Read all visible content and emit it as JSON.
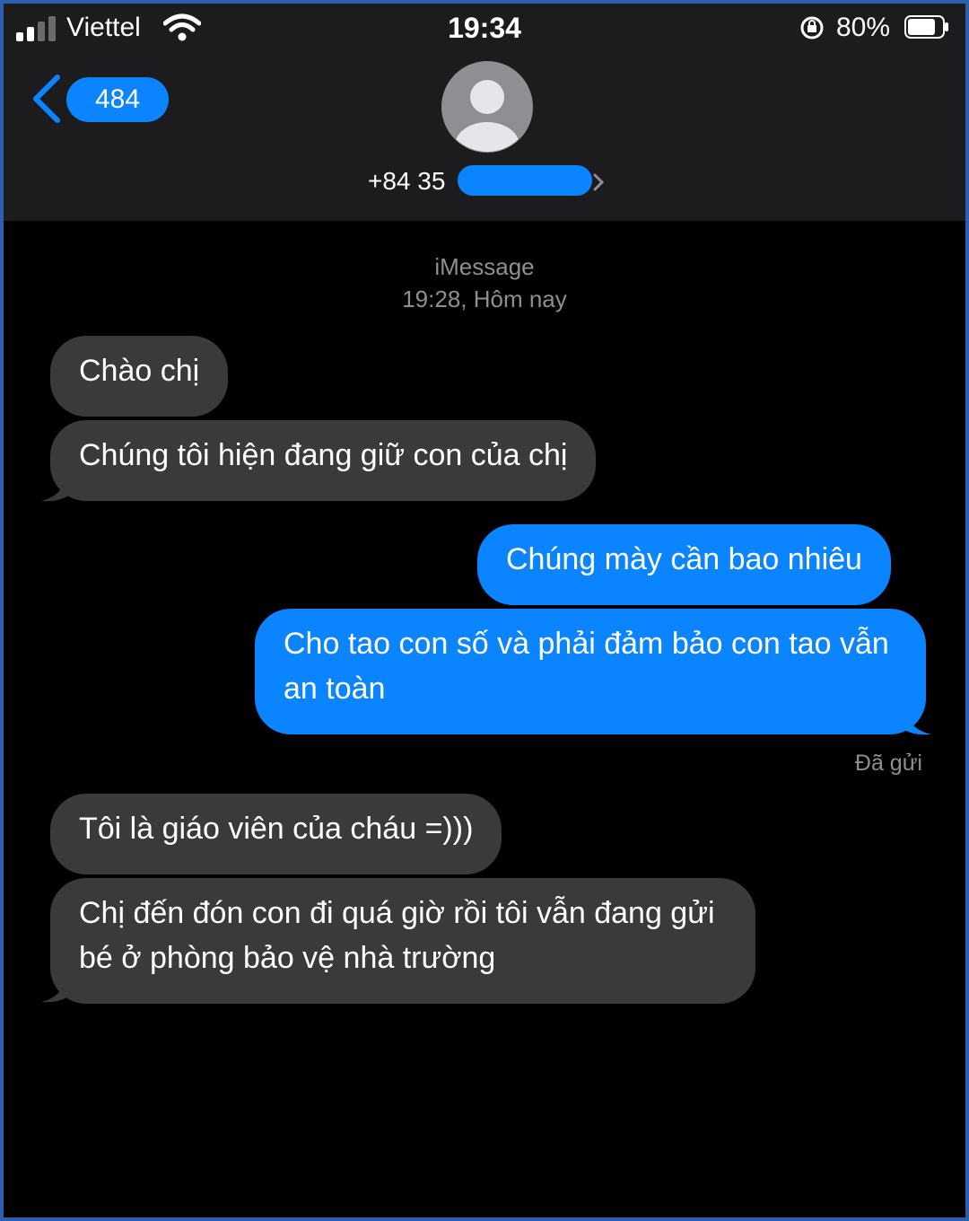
{
  "status_bar": {
    "carrier": "Viettel",
    "time": "19:34",
    "battery_percent": "80%",
    "signal_bars_full": 2,
    "battery_level": 0.8
  },
  "header": {
    "back_count": "484",
    "contact_number_visible": "+84 35"
  },
  "conversation": {
    "service": "iMessage",
    "timestamp": "19:28, Hôm nay",
    "messages": [
      {
        "direction": "incoming",
        "text": "Chào chị"
      },
      {
        "direction": "incoming",
        "text": "Chúng tôi hiện đang giữ con của chị"
      },
      {
        "direction": "outgoing",
        "text": "Chúng mày cần bao nhiêu"
      },
      {
        "direction": "outgoing",
        "text": "Cho tao con số và phải đảm bảo con tao vẫn an toàn"
      },
      {
        "direction": "incoming",
        "text": "Tôi là giáo viên của cháu =)))"
      },
      {
        "direction": "incoming",
        "text": "Chị đến đón con đi quá giờ rồi tôi vẫn đang gửi bé ở phòng bảo vệ nhà trường"
      }
    ],
    "delivery_status": "Đã gửi"
  },
  "colors": {
    "incoming_bubble": "#3a3a3c",
    "outgoing_bubble": "#0a84ff",
    "header_bg": "#1c1c1e",
    "background": "#000000"
  },
  "icons": [
    "signal-icon",
    "wifi-icon",
    "orientation-lock-icon",
    "battery-icon",
    "back-chevron-icon",
    "contact-avatar-icon",
    "chevron-right-icon"
  ]
}
